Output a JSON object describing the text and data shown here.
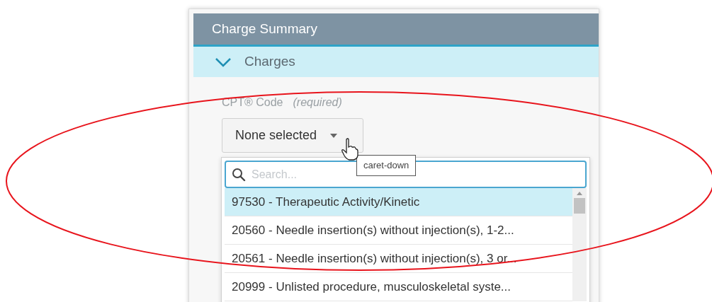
{
  "panel": {
    "title": "Charge Summary"
  },
  "section": {
    "label": "Charges",
    "expanded": true
  },
  "field": {
    "label": "CPT® Code",
    "hint": "(required)",
    "value": "None selected",
    "expanded": true
  },
  "tooltip": {
    "text": "caret-down"
  },
  "dropdown": {
    "search": {
      "placeholder": "Search..."
    },
    "options": [
      {
        "text": "97530 - Therapeutic Activity/Kinetic",
        "selected": true
      },
      {
        "text": "20560 - Needle insertion(s) without injection(s), 1-2...",
        "selected": false
      },
      {
        "text": "20561 - Needle insertion(s) without injection(s), 3 or...",
        "selected": false
      },
      {
        "text": "20999 - Unlisted procedure, musculoskeletal syste...",
        "selected": false
      }
    ]
  }
}
